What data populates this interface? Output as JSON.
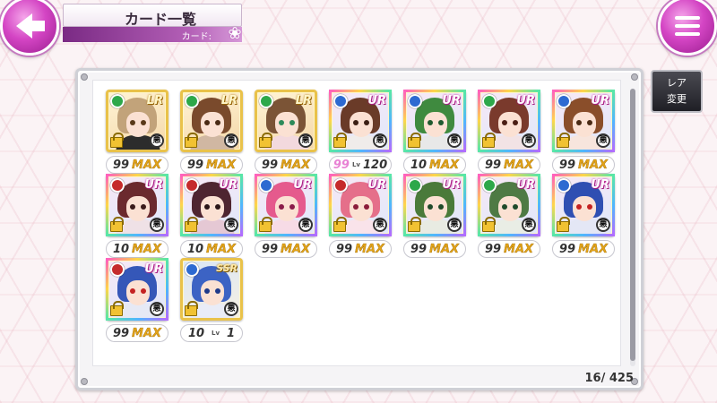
{
  "header": {
    "title": "カード一覧",
    "subtitle": "カード",
    "flower_icon": "❀"
  },
  "side": {
    "rarity_button": {
      "line1": "レア",
      "line2": "変更"
    }
  },
  "panel": {
    "counter": "16/  425"
  },
  "colors": {
    "accent": "#c23fb8",
    "gold": "#e9c24a"
  },
  "cards": [
    {
      "rarity": "LR",
      "element_color": "#2da84a",
      "hair": "#c2a37a",
      "eye": "#5a3a1a",
      "outfit": "#2c2c2c",
      "level": "99",
      "max": "MAX",
      "kanji": "悪"
    },
    {
      "rarity": "LR",
      "element_color": "#2da84a",
      "hair": "#7a4a2c",
      "eye": "#4a2a14",
      "outfit": "#d0b7a2",
      "level": "99",
      "max": "MAX",
      "kanji": "悪"
    },
    {
      "rarity": "LR",
      "element_color": "#2da84a",
      "hair": "#7b5436",
      "eye": "#2e8a5a",
      "outfit": "#f3d9de",
      "level": "99",
      "max": "MAX",
      "kanji": "悪"
    },
    {
      "rarity": "UR",
      "element_color": "#2d6ad1",
      "hair": "#6a3b28",
      "eye": "#3b1f14",
      "outfit": "#f0ecea",
      "level": "99",
      "levelsmall": "Lv",
      "max": "120",
      "kanji": "悪",
      "pink": true
    },
    {
      "rarity": "UR",
      "element_color": "#2d6ad1",
      "hair": "#3f8a3f",
      "eye": "#1f5a2f",
      "outfit": "#e8e8e8",
      "level": "10",
      "max": "MAX",
      "kanji": "悪"
    },
    {
      "rarity": "UR",
      "element_color": "#2da84a",
      "hair": "#7a3a2c",
      "eye": "#4a1f14",
      "outfit": "#f2e3e5",
      "level": "99",
      "max": "MAX",
      "kanji": "悪"
    },
    {
      "rarity": "UR",
      "element_color": "#2d6ad1",
      "hair": "#8a4e2a",
      "eye": "#4a2a14",
      "outfit": "#f7e5dd",
      "level": "99",
      "max": "MAX",
      "kanji": "悪"
    },
    {
      "rarity": "UR",
      "element_color": "#c52b2b",
      "hair": "#6b2a2e",
      "eye": "#3a1a1a",
      "outfit": "#efe1e6",
      "level": "10",
      "max": "MAX",
      "kanji": "悪"
    },
    {
      "rarity": "UR",
      "element_color": "#c52b2b",
      "hair": "#4e2530",
      "eye": "#2a1618",
      "outfit": "#e5c8d4",
      "level": "10",
      "max": "MAX",
      "kanji": "悪"
    },
    {
      "rarity": "UR",
      "element_color": "#2d6ad1",
      "hair": "#e55a8d",
      "eye": "#8b1c4a",
      "outfit": "#f7dbe6",
      "level": "99",
      "max": "MAX",
      "kanji": "悪"
    },
    {
      "rarity": "UR",
      "element_color": "#c52b2b",
      "hair": "#e56f8a",
      "eye": "#8b1c3a",
      "outfit": "#f9e3ea",
      "level": "99",
      "max": "MAX",
      "kanji": "悪"
    },
    {
      "rarity": "UR",
      "element_color": "#2da84a",
      "hair": "#4a7a3a",
      "eye": "#1f4a2a",
      "outfit": "#e8ebe2",
      "level": "99",
      "max": "MAX",
      "kanji": "悪"
    },
    {
      "rarity": "UR",
      "element_color": "#2da84a",
      "hair": "#4e7a44",
      "eye": "#1f4a2a",
      "outfit": "#e9ede5",
      "level": "99",
      "max": "MAX",
      "kanji": "悪"
    },
    {
      "rarity": "UR",
      "element_color": "#2d6ad1",
      "hair": "#2f4fb2",
      "eye": "#c42222",
      "outfit": "#e4e7f5",
      "level": "99",
      "max": "MAX",
      "kanji": "悪"
    },
    {
      "rarity": "UR",
      "element_color": "#c52b2b",
      "hair": "#3557b8",
      "eye": "#c42222",
      "outfit": "#e6e9f5",
      "level": "99",
      "max": "MAX",
      "kanji": "悪"
    },
    {
      "rarity": "SSR",
      "element_color": "#2d6ad1",
      "hair": "#3c63c4",
      "eye": "#1f3a8a",
      "outfit": "#e9ecf7",
      "level": "10",
      "levelsmall": "Lv",
      "max": "1",
      "kanji": "悪",
      "plain": true
    }
  ]
}
